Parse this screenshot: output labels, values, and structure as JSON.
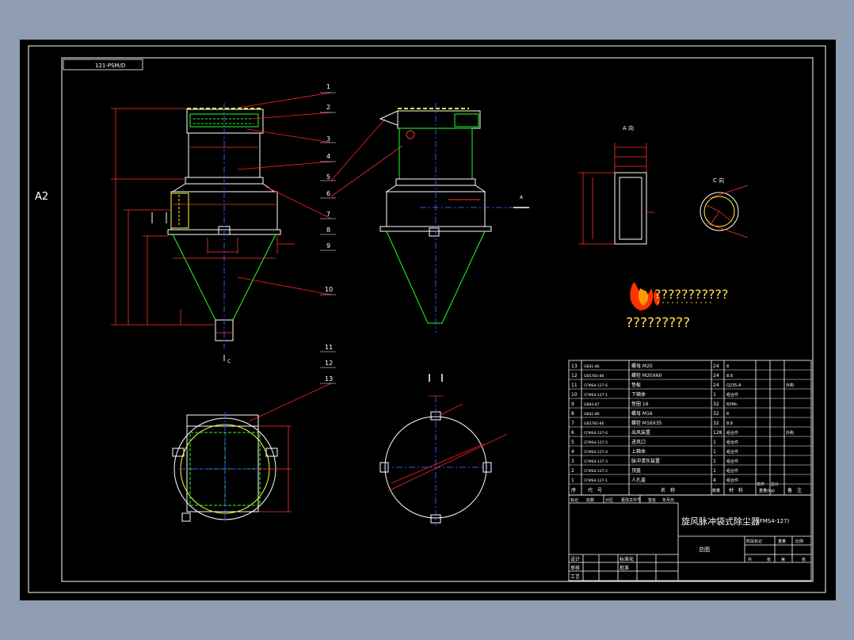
{
  "background": "#8f9db2",
  "canvas_color": "#000000",
  "sheet": {
    "size_label": "A2",
    "drawing_code": "121-PSM/D"
  },
  "part_callouts": [
    "1",
    "2",
    "3",
    "4",
    "5",
    "6",
    "7",
    "8",
    "9",
    "10",
    "11",
    "12",
    "13"
  ],
  "view_labels": {
    "view_a": "A 向",
    "view_c": "C 向",
    "section_a": "A",
    "section_c": "C"
  },
  "logo": {
    "line1": "???????????",
    "line2": "?????????",
    "colors": [
      "#ff3300",
      "#ff9900",
      "#ffcc00"
    ]
  },
  "bom": {
    "rows": [
      {
        "no": "13",
        "code": "GB41-86",
        "name": "螺母  M20",
        "qty": "24",
        "mat": "8",
        "note": ""
      },
      {
        "no": "12",
        "code": "GB5782-86",
        "name": "螺栓  M20X60",
        "qty": "24",
        "mat": "8.8",
        "note": ""
      },
      {
        "no": "11",
        "code": "CFMS4-127-6",
        "name": "垫板",
        "qty": "24",
        "mat": "Q235-A",
        "note": "外购"
      },
      {
        "no": "10",
        "code": "CFMS4-127-1",
        "name": "下箱体",
        "qty": "1",
        "mat": "组合件",
        "note": ""
      },
      {
        "no": "9",
        "code": "GB93-87",
        "name": "垫圈  16",
        "qty": "32",
        "mat": "65Mn",
        "note": ""
      },
      {
        "no": "8",
        "code": "GB41-86",
        "name": "螺母  M16",
        "qty": "32",
        "mat": "8",
        "note": ""
      },
      {
        "no": "7",
        "code": "GB5782-86",
        "name": "螺栓  M16X35",
        "qty": "32",
        "mat": "8.8",
        "note": ""
      },
      {
        "no": "6",
        "code": "CFMS4-127-6",
        "name": "出风装置",
        "qty": "128",
        "mat": "组合件",
        "note": "外购"
      },
      {
        "no": "5",
        "code": "CFMS4-127-5",
        "name": "进风口",
        "qty": "1",
        "mat": "组合件",
        "note": ""
      },
      {
        "no": "4",
        "code": "CFMS4-127-4",
        "name": "上箱体",
        "qty": "1",
        "mat": "组合件",
        "note": ""
      },
      {
        "no": "3",
        "code": "CFMS4-127-3",
        "name": "脉冲清灰装置",
        "qty": "1",
        "mat": "组合件",
        "note": ""
      },
      {
        "no": "2",
        "code": "CFMS4-127-2",
        "name": "顶盖",
        "qty": "1",
        "mat": "组合件",
        "note": ""
      },
      {
        "no": "1",
        "code": "CFMS4-127-1",
        "name": "人孔盖",
        "qty": "4",
        "mat": "组合件",
        "note": ""
      }
    ],
    "header": {
      "no": "序",
      "code": "代　号",
      "name": "名　称",
      "qty": "数量",
      "mat": "材　料",
      "unit": "单件",
      "total": "总计",
      "weight": "重量(kg)",
      "note": "备　注"
    }
  },
  "title_block": {
    "title": "旋风脉冲袋式除尘器",
    "model": "(FMS4-127)",
    "drawing_type": "总图",
    "row_labels": [
      "标记",
      "处数",
      "分区",
      "更改文件号",
      "签名",
      "年月日"
    ],
    "sign_labels": [
      "设计",
      "审核",
      "工艺"
    ],
    "std_labels": [
      "标准化",
      "批准"
    ],
    "stage_labels": [
      "阶段标记",
      "重量",
      "比例"
    ],
    "sheet_labels": [
      "共",
      "张",
      "第",
      "张"
    ]
  }
}
